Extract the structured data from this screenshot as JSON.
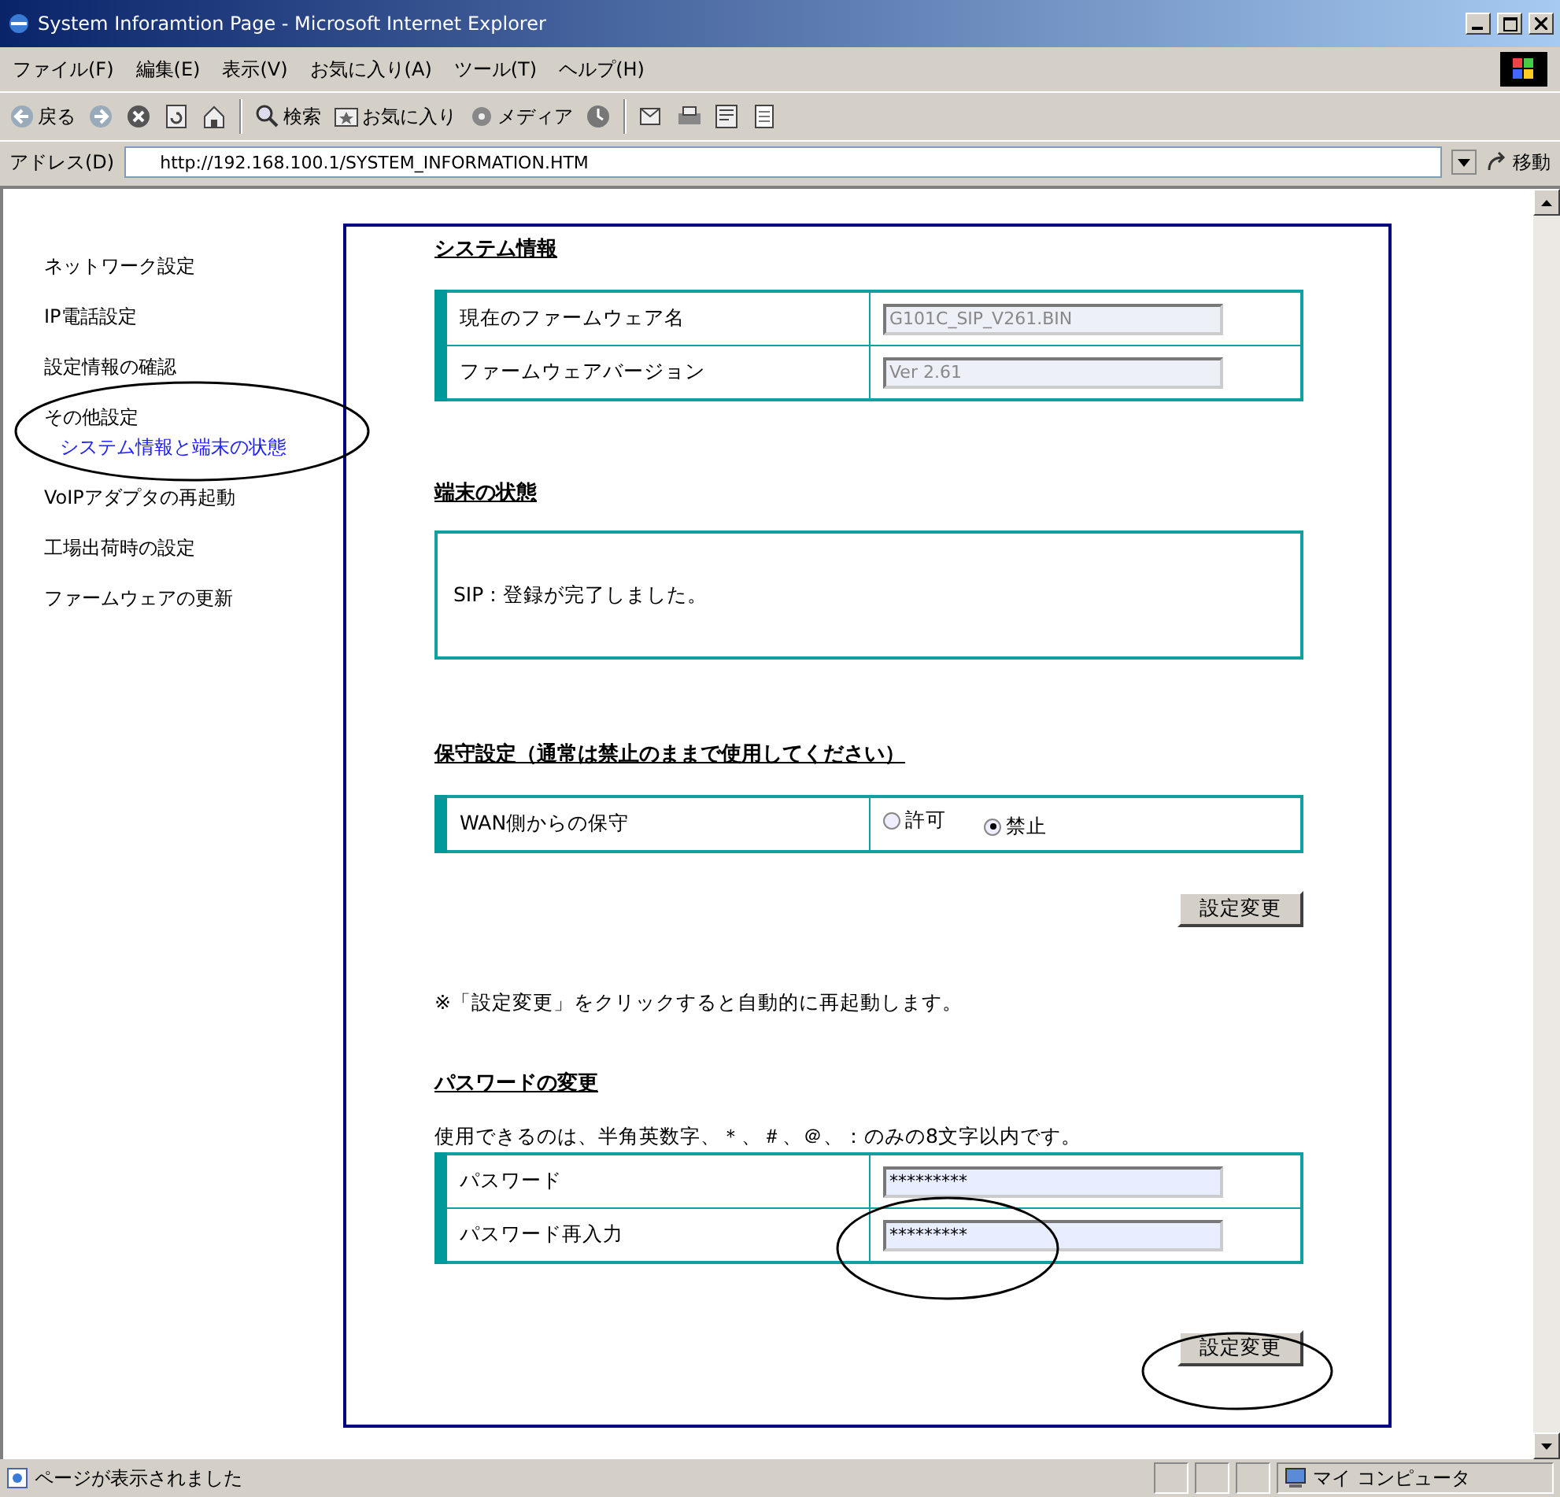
{
  "window": {
    "title": "System Inforamtion Page - Microsoft Internet Explorer"
  },
  "menu": [
    "ファイル(F)",
    "編集(E)",
    "表示(V)",
    "お気に入り(A)",
    "ツール(T)",
    "ヘルプ(H)"
  ],
  "toolbar": [
    {
      "kind": "back",
      "label": "戻る"
    },
    {
      "kind": "forward"
    },
    {
      "kind": "stop"
    },
    {
      "kind": "refresh"
    },
    {
      "kind": "home"
    },
    {
      "kind": "search",
      "label": "検索"
    },
    {
      "kind": "favorites",
      "label": "お気に入り"
    },
    {
      "kind": "media",
      "label": "メディア"
    },
    {
      "kind": "history"
    },
    {
      "kind": "mail"
    },
    {
      "kind": "print"
    },
    {
      "kind": "edit"
    },
    {
      "kind": "discuss"
    }
  ],
  "address": {
    "label": "アドレス(D)",
    "url": "http://192.168.100.1/SYSTEM_INFORMATION.HTM",
    "go": "移動"
  },
  "sidebar": {
    "items": [
      {
        "label": "ネットワーク設定",
        "selected": false
      },
      {
        "label": "IP電話設定",
        "selected": false
      },
      {
        "label": "設定情報の確認",
        "selected": false
      },
      {
        "label": "その他設定",
        "selected": false,
        "children": [
          {
            "label": "システム情報と端末の状態",
            "selected": true
          }
        ]
      },
      {
        "label": "VoIPアダプタの再起動",
        "selected": false
      },
      {
        "label": "工場出荷時の設定",
        "selected": false
      },
      {
        "label": "ファームウェアの更新",
        "selected": false
      }
    ]
  },
  "sections": [
    {
      "kind": "fields",
      "heading": "システム情報",
      "rows": [
        {
          "label": "現在のファームウェア名",
          "value": "G101C_SIP_V261.BIN",
          "disabled": true
        },
        {
          "label": "ファームウェアバージョン",
          "value": "Ver 2.61",
          "disabled": true
        }
      ]
    },
    {
      "kind": "message",
      "heading": "端末の状態",
      "text": "SIP : 登録が完了しました。"
    },
    {
      "kind": "radio",
      "heading": "保守設定（通常は禁止のままで使用してください）",
      "rows": [
        {
          "label": "WAN側からの保守",
          "options": [
            {
              "label": "許可",
              "selected": false
            },
            {
              "label": "禁止",
              "selected": true
            }
          ]
        }
      ],
      "button": "設定変更",
      "note": "※「設定変更」をクリックすると自動的に再起動します。"
    },
    {
      "kind": "fields",
      "heading": "パスワードの変更",
      "hint": "使用できるのは、半角英数字、＊、＃、＠、：のみの8文字以内です。",
      "rows": [
        {
          "label": "パスワード",
          "value": "*********",
          "disabled": false
        },
        {
          "label": "パスワード再入力",
          "value": "*********",
          "disabled": false
        }
      ],
      "button": "設定変更"
    }
  ],
  "status_bar": {
    "text": "ページが表示されました",
    "zone": "マイ コンピュータ"
  }
}
